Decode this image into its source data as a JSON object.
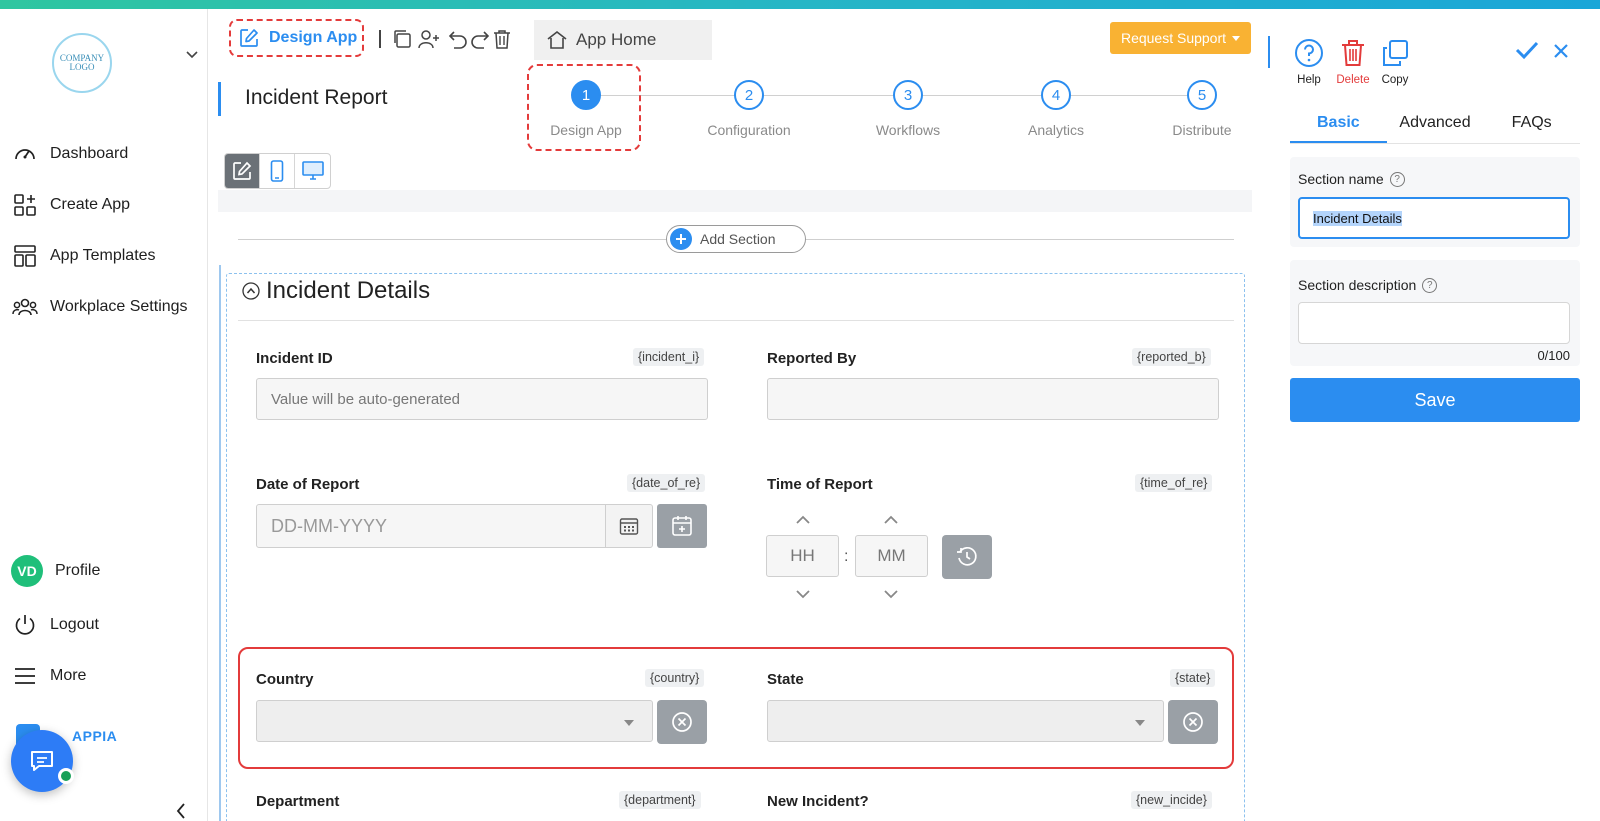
{
  "colors": {
    "accent": "#2b8df0",
    "warning": "#f9b233",
    "danger": "#e33b3b",
    "avatar": "#1fbf7a"
  },
  "sidebar": {
    "logo_text": "COMPANY LOGO",
    "items": [
      {
        "label": "Dashboard",
        "icon": "gauge-icon"
      },
      {
        "label": "Create App",
        "icon": "add-app-icon"
      },
      {
        "label": "App Templates",
        "icon": "template-icon"
      },
      {
        "label": "Workplace Settings",
        "icon": "users-icon"
      }
    ],
    "profile": {
      "initials": "VD",
      "label": "Profile"
    },
    "logout_label": "Logout",
    "more_label": "More",
    "brand_text": "APPIA"
  },
  "toolbar": {
    "design_app_label": "Design App",
    "app_home_label": "App Home",
    "request_support_label": "Request Support"
  },
  "page": {
    "title": "Incident Report"
  },
  "stepper": {
    "active_index": 0,
    "steps": [
      {
        "num": "1",
        "label": "Design App"
      },
      {
        "num": "2",
        "label": "Configuration"
      },
      {
        "num": "3",
        "label": "Workflows"
      },
      {
        "num": "4",
        "label": "Analytics"
      },
      {
        "num": "5",
        "label": "Distribute"
      }
    ]
  },
  "canvas": {
    "add_section_label": "Add Section",
    "section_title": "Incident Details",
    "fields": {
      "incident_id": {
        "label": "Incident ID",
        "tag": "{incident_i}",
        "placeholder": "Value will be auto-generated"
      },
      "reported_by": {
        "label": "Reported By",
        "tag": "{reported_b}",
        "value": ""
      },
      "date_of_report": {
        "label": "Date of Report",
        "tag": "{date_of_re}",
        "placeholder": "DD-MM-YYYY"
      },
      "time_of_report": {
        "label": "Time of Report",
        "tag": "{time_of_re}",
        "hh": "HH",
        "mm": "MM",
        "separator": ":"
      },
      "country": {
        "label": "Country",
        "tag": "{country}"
      },
      "state": {
        "label": "State",
        "tag": "{state}"
      },
      "department": {
        "label": "Department",
        "tag": "{department}"
      },
      "new_incident": {
        "label": "New Incident?",
        "tag": "{new_incide}"
      }
    }
  },
  "right_panel": {
    "actions": {
      "help": "Help",
      "delete": "Delete",
      "copy": "Copy"
    },
    "tabs": [
      "Basic",
      "Advanced",
      "FAQs"
    ],
    "active_tab": 0,
    "section_name_label": "Section name",
    "section_name_value": "Incident Details",
    "section_description_label": "Section description",
    "section_description_value": "",
    "counter": "0/100",
    "save_label": "Save"
  }
}
